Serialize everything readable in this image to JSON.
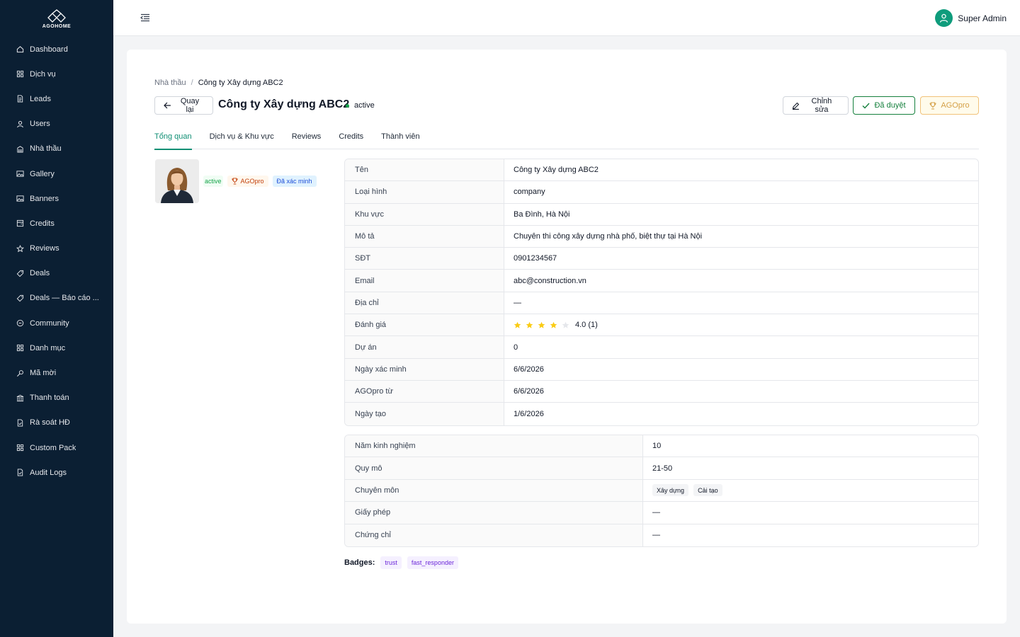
{
  "brand": {
    "logo_text": "AGOHOME"
  },
  "sidebar": {
    "items": [
      {
        "label": "Dashboard",
        "icon": "home-icon"
      },
      {
        "label": "Dịch vụ",
        "icon": "grid-icon"
      },
      {
        "label": "Leads",
        "icon": "file-icon"
      },
      {
        "label": "Users",
        "icon": "user-icon"
      },
      {
        "label": "Nhà thầu",
        "icon": "building-icon"
      },
      {
        "label": "Gallery",
        "icon": "image-icon"
      },
      {
        "label": "Banners",
        "icon": "image-icon"
      },
      {
        "label": "Credits",
        "icon": "wallet-icon"
      },
      {
        "label": "Reviews",
        "icon": "star-icon"
      },
      {
        "label": "Deals",
        "icon": "tag-icon"
      },
      {
        "label": "Deals — Báo cáo ...",
        "icon": "tag-icon"
      },
      {
        "label": "Community",
        "icon": "chat-icon"
      },
      {
        "label": "Danh mục",
        "icon": "grid-icon"
      },
      {
        "label": "Mã mời",
        "icon": "key-icon"
      },
      {
        "label": "Thanh toán",
        "icon": "bank-icon"
      },
      {
        "label": "Rà soát HĐ",
        "icon": "file-check-icon"
      },
      {
        "label": "Custom Pack",
        "icon": "grid-icon"
      },
      {
        "label": "Audit Logs",
        "icon": "file-check-icon"
      }
    ]
  },
  "topbar": {
    "user_name": "Super Admin"
  },
  "breadcrumb": {
    "parent": "Nhà thầu",
    "separator": "/",
    "current": "Công ty Xây dựng ABC2"
  },
  "header": {
    "back_label": "Quay lại",
    "title": "Công ty Xây dựng ABC2",
    "status": "active",
    "edit_label": "Chỉnh sửa",
    "approved_label": "Đã duyệt",
    "agopro_label": "AGOpro"
  },
  "tabs": [
    {
      "label": "Tổng quan",
      "active": true
    },
    {
      "label": "Dịch vụ & Khu vực",
      "active": false
    },
    {
      "label": "Reviews",
      "active": false
    },
    {
      "label": "Credits",
      "active": false
    },
    {
      "label": "Thành viên",
      "active": false
    }
  ],
  "profile": {
    "status_tag": "active",
    "agopro_tag": "AGOpro",
    "verified_tag": "Đã xác minh"
  },
  "details": [
    {
      "key": "Tên",
      "value": "Công ty Xây dựng ABC2"
    },
    {
      "key": "Loại hình",
      "value": "company"
    },
    {
      "key": "Khu vực",
      "value": "Ba Đình, Hà Nội"
    },
    {
      "key": "Mô tả",
      "value": "Chuyên thi công xây dựng nhà phố, biệt thự tại Hà Nội"
    },
    {
      "key": "SĐT",
      "value": "0901234567"
    },
    {
      "key": "Email",
      "value": "abc@construction.vn"
    },
    {
      "key": "Địa chỉ",
      "value": "—"
    },
    {
      "key": "Đánh giá",
      "value": "4.0 (1)",
      "rating": 4,
      "max_rating": 5
    },
    {
      "key": "Dự án",
      "value": "0"
    },
    {
      "key": "Ngày xác minh",
      "value": "6/6/2026"
    },
    {
      "key": "AGOpro từ",
      "value": "6/6/2026"
    },
    {
      "key": "Ngày tạo",
      "value": "1/6/2026"
    }
  ],
  "details2": [
    {
      "key": "Năm kinh nghiệm",
      "value": "10"
    },
    {
      "key": "Quy mô",
      "value": "21-50"
    },
    {
      "key": "Chuyên môn",
      "chips": [
        "Xây dựng",
        "Cải tạo"
      ]
    },
    {
      "key": "Giấy phép",
      "value": "—"
    },
    {
      "key": "Chứng chỉ",
      "value": "—"
    }
  ],
  "badges": {
    "label": "Badges:",
    "items": [
      "trust",
      "fast_responder"
    ]
  },
  "colors": {
    "sidebar_bg": "#0b1f33",
    "accent": "#0f8f74",
    "star": "#facc15",
    "approved": "#15803d"
  }
}
